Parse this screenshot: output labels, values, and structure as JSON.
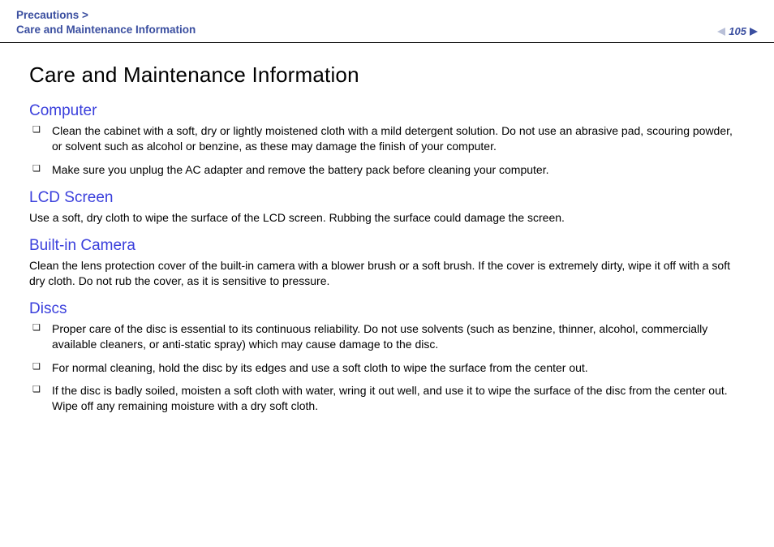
{
  "header": {
    "breadcrumb_parent": "Precautions",
    "breadcrumb_sep": ">",
    "breadcrumb_current": "Care and Maintenance Information",
    "page_number": "105",
    "n_link": "n",
    "big_n": "N"
  },
  "title": "Care and Maintenance Information",
  "sections": {
    "computer": {
      "heading": "Computer",
      "items": [
        "Clean the cabinet with a soft, dry or lightly moistened cloth with a mild detergent solution. Do not use an abrasive pad, scouring powder, or solvent such as alcohol or benzine, as these may damage the finish of your computer.",
        "Make sure you unplug the AC adapter and remove the battery pack before cleaning your computer."
      ]
    },
    "lcd": {
      "heading": "LCD Screen",
      "text": "Use a soft, dry cloth to wipe the surface of the LCD screen. Rubbing the surface could damage the screen."
    },
    "camera": {
      "heading": "Built-in Camera",
      "text": "Clean the lens protection cover of the built-in camera with a blower brush or a soft brush. If the cover is extremely dirty, wipe it off with a soft dry cloth. Do not rub the cover, as it is sensitive to pressure."
    },
    "discs": {
      "heading": "Discs",
      "items": [
        "Proper care of the disc is essential to its continuous reliability. Do not use solvents (such as benzine, thinner, alcohol, commercially available cleaners, or anti-static spray) which may cause damage to the disc.",
        "For normal cleaning, hold the disc by its edges and use a soft cloth to wipe the surface from the center out.",
        "If the disc is badly soiled, moisten a soft cloth with water, wring it out well, and use it to wipe the surface of the disc from the center out. Wipe off any remaining moisture with a dry soft cloth."
      ]
    }
  }
}
